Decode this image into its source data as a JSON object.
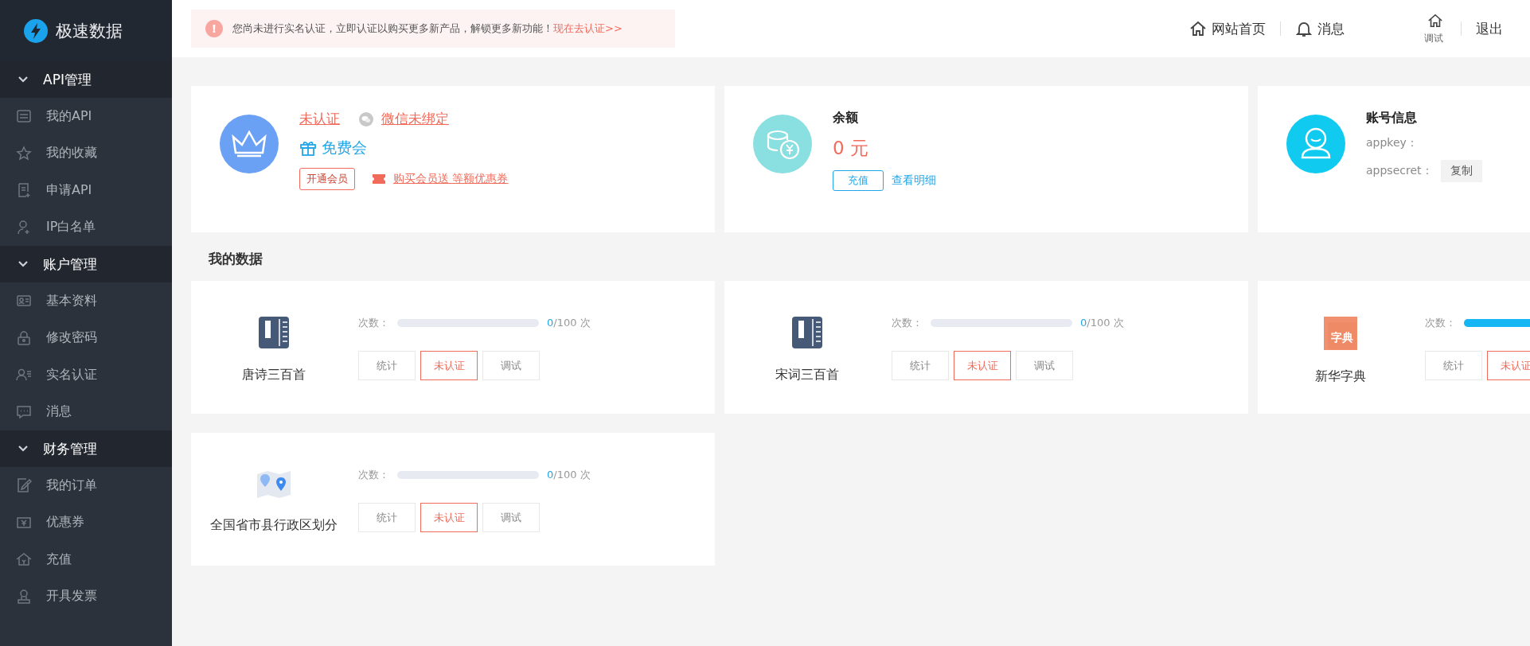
{
  "logo": {
    "text": "极速数据"
  },
  "notice": {
    "icon": "!",
    "text": "您尚未进行实名认证，立即认证以购买更多新产品，解锁更多新功能！",
    "link": "现在去认证>>"
  },
  "header_nav": [
    {
      "kind": "home",
      "label": "网站首页"
    },
    {
      "kind": "bell",
      "label": "消息"
    },
    {
      "kind": "home-small",
      "label": "调试"
    },
    {
      "kind": "plain",
      "label": "退出"
    }
  ],
  "sidebar": {
    "groups": [
      {
        "label": "API管理",
        "expanded": true,
        "children": [
          {
            "label": "我的API"
          },
          {
            "label": "我的收藏"
          },
          {
            "label": "申请API"
          },
          {
            "label": "IP白名单"
          }
        ]
      },
      {
        "label": "账户管理",
        "expanded": true,
        "children": [
          {
            "label": "基本资料"
          },
          {
            "label": "修改密码"
          },
          {
            "label": "实名认证"
          },
          {
            "label": "消息"
          }
        ]
      },
      {
        "label": "财务管理",
        "expanded": true,
        "children": [
          {
            "label": "我的订单"
          },
          {
            "label": "优惠券"
          },
          {
            "label": "充值"
          },
          {
            "label": "开具发票"
          }
        ]
      }
    ]
  },
  "member_card": {
    "verify_status": "未认证",
    "wechat_status": "微信未绑定",
    "level": "免费会",
    "open_button": "开通会员",
    "promo_link": "购买会员送 等额优惠券"
  },
  "balance_card": {
    "title": "余额",
    "amount": "0 元",
    "recharge_button": "充值",
    "detail_link": "查看明细"
  },
  "account_card": {
    "title": "账号信息",
    "appkey_label": "appkey：",
    "appsecret_label": "appsecret：",
    "copy_button": "复制"
  },
  "section_title": "我的数据",
  "data_cards": [
    {
      "kind": "book",
      "name": "唐诗三百首",
      "count_label": "次数：",
      "level": 0,
      "used": "0",
      "total": "/100 次",
      "buttons": [
        {
          "label": "统计",
          "kind": "plain"
        },
        {
          "label": "未认证",
          "kind": "warn"
        },
        {
          "label": "调试",
          "kind": "plain"
        }
      ]
    },
    {
      "kind": "book",
      "name": "宋词三百首",
      "count_label": "次数：",
      "level": 0,
      "used": "0",
      "total": "/100 次",
      "buttons": [
        {
          "label": "统计",
          "kind": "plain"
        },
        {
          "label": "未认证",
          "kind": "warn"
        },
        {
          "label": "调试",
          "kind": "plain"
        }
      ]
    },
    {
      "kind": "dictionary",
      "icon_text": "字典",
      "name": "新华字典",
      "count_label": "次数：",
      "level": 1,
      "buttons": [
        {
          "label": "统计",
          "kind": "plain"
        },
        {
          "label": "未认证",
          "kind": "warn"
        }
      ]
    },
    {
      "kind": "map",
      "name": "全国省市县行政区划分",
      "count_label": "次数：",
      "level": 0,
      "used": "0",
      "total": "/100 次",
      "buttons": [
        {
          "label": "统计",
          "kind": "plain"
        },
        {
          "label": "未认证",
          "kind": "warn"
        },
        {
          "label": "调试",
          "kind": "plain"
        }
      ]
    }
  ]
}
